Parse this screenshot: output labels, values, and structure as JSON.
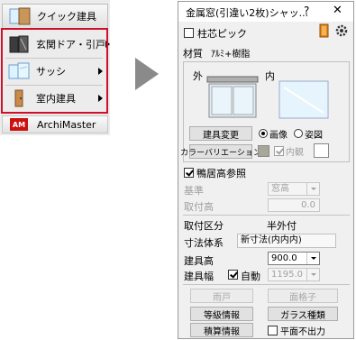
{
  "menu": {
    "items": [
      {
        "label": "クイック建具",
        "icon": "quick-fixture-icon",
        "has_submenu": false
      },
      {
        "label": "玄関ドア・引戸",
        "icon": "entrance-door-icon",
        "has_submenu": true
      },
      {
        "label": "サッシ",
        "icon": "sash-window-icon",
        "has_submenu": true
      },
      {
        "label": "室内建具",
        "icon": "interior-door-icon",
        "has_submenu": true
      },
      {
        "label": "ArchiMaster",
        "icon": "archimaster-logo-icon",
        "logo_text": "AM",
        "has_submenu": false
      }
    ]
  },
  "dialog": {
    "title": "金属窓(引違い2枚)シャッ...",
    "help": "?",
    "close": "✕",
    "pillar_pick_label": "柱芯ピック",
    "material_label": "材質",
    "material_value": "ｱﾙﾐ+樹脂",
    "outside_label": "外",
    "inside_label": "内",
    "change_fixture_button": "建具変更",
    "radio_image": "画像",
    "radio_view": "姿図",
    "color_variation_button": "カラーバリエーション",
    "inside_view_label": "内観",
    "head_height_label": "鴨居高参照",
    "base_label": "基準",
    "base_value": "窓高",
    "mount_height_label": "取付高",
    "mount_height_value": "0.0",
    "mount_type_label": "取付区分",
    "mount_type_value": "半外付",
    "dimension_system_label": "寸法体系",
    "dimension_system_value": "新寸法(内内内)",
    "fixture_height_label": "建具高",
    "fixture_height_value": "900.0",
    "fixture_width_label": "建具幅",
    "auto_label": "自動",
    "fixture_width_value": "1195.0",
    "rain_door_button": "雨戸",
    "surface_grille_button": "面格子",
    "grade_info_button": "等級情報",
    "glass_type_button": "ガラス種類",
    "estimate_info_button": "積算情報",
    "no_plan_output_label": "平面不出力"
  },
  "colors": {
    "highlight_red": "#d0102a",
    "arrow_gray": "#8a8a8a",
    "logo_red": "#cc1111"
  }
}
